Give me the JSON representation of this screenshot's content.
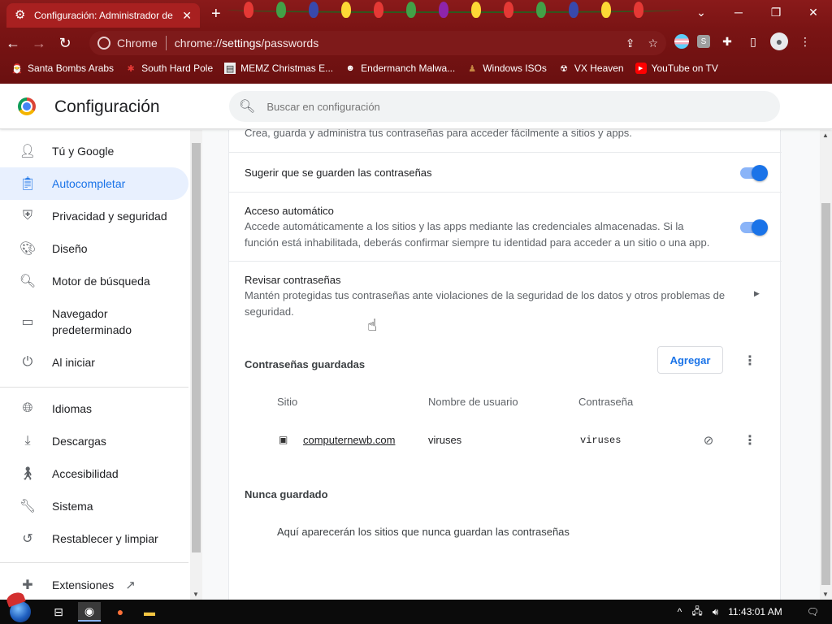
{
  "browser": {
    "tab_title": "Configuración: Administrador de",
    "omnibox_chip": "Chrome",
    "url_prefix": "chrome://",
    "url_bold": "settings",
    "url_suffix": "/passwords",
    "bookmarks": [
      {
        "label": "Santa Bombs Arabs",
        "icon": "santa-icon"
      },
      {
        "label": "South Hard Pole",
        "icon": "snowflake-icon"
      },
      {
        "label": "MEMZ Christmas E...",
        "icon": "memz-icon"
      },
      {
        "label": "Endermanch Malwa...",
        "icon": "raccoon-icon"
      },
      {
        "label": "Windows ISOs",
        "icon": "gingerbread-icon"
      },
      {
        "label": "VX Heaven",
        "icon": "vx-heaven-icon"
      },
      {
        "label": "YouTube on TV",
        "icon": "youtube-icon"
      }
    ]
  },
  "header": {
    "title": "Configuración",
    "search_placeholder": "Buscar en configuración"
  },
  "sidebar": {
    "items": [
      {
        "label": "Tú y Google",
        "icon": "person-icon"
      },
      {
        "label": "Autocompletar",
        "icon": "clipboard-icon",
        "active": true
      },
      {
        "label": "Privacidad y seguridad",
        "icon": "shield-icon"
      },
      {
        "label": "Diseño",
        "icon": "palette-icon"
      },
      {
        "label": "Motor de búsqueda",
        "icon": "search-icon"
      },
      {
        "label": "Navegador predeterminado",
        "icon": "browser-icon"
      },
      {
        "label": "Al iniciar",
        "icon": "power-icon"
      },
      {
        "label": "Idiomas",
        "icon": "globe-icon"
      },
      {
        "label": "Descargas",
        "icon": "download-icon"
      },
      {
        "label": "Accesibilidad",
        "icon": "accessibility-icon"
      },
      {
        "label": "Sistema",
        "icon": "wrench-icon"
      },
      {
        "label": "Restablecer y limpiar",
        "icon": "restore-icon"
      },
      {
        "label": "Extensiones",
        "icon": "puzzle-icon"
      }
    ]
  },
  "main": {
    "top_partial_text": "Crea, guarda y administra tus contraseñas para acceder fácilmente a sitios y apps.",
    "offer_save": {
      "label": "Sugerir que se guarden las contraseñas",
      "enabled": true
    },
    "auto_signin": {
      "label": "Acceso automático",
      "description_line1": "Accede automáticamente a los sitios y las apps mediante las credenciales almacenadas. Si la",
      "description_line2": "función está inhabilitada, deberás confirmar siempre tu identidad para acceder a un sitio o una app.",
      "enabled": true
    },
    "check_passwords": {
      "label": "Revisar contraseñas",
      "description_line1": "Mantén protegidas tus contraseñas ante violaciones de la seguridad de los datos y otros problemas de",
      "description_line2": "seguridad."
    },
    "saved_passwords": {
      "heading": "Contraseñas guardadas",
      "add_button": "Agregar",
      "columns": [
        "Sitio",
        "Nombre de usuario",
        "Contraseña"
      ],
      "rows": [
        {
          "site": "computernewb.com",
          "username": "viruses",
          "password": "viruses"
        }
      ]
    },
    "never_saved": {
      "heading": "Nunca guardado",
      "empty_text": "Aquí aparecerán los sitios que nunca guardan las contraseñas"
    }
  },
  "taskbar": {
    "clock": "11:43:01 AM"
  },
  "colors": {
    "accent": "#1a73e8",
    "chrome_frame": "#8a1a1a",
    "active_nav_bg": "#e8f0fe"
  }
}
